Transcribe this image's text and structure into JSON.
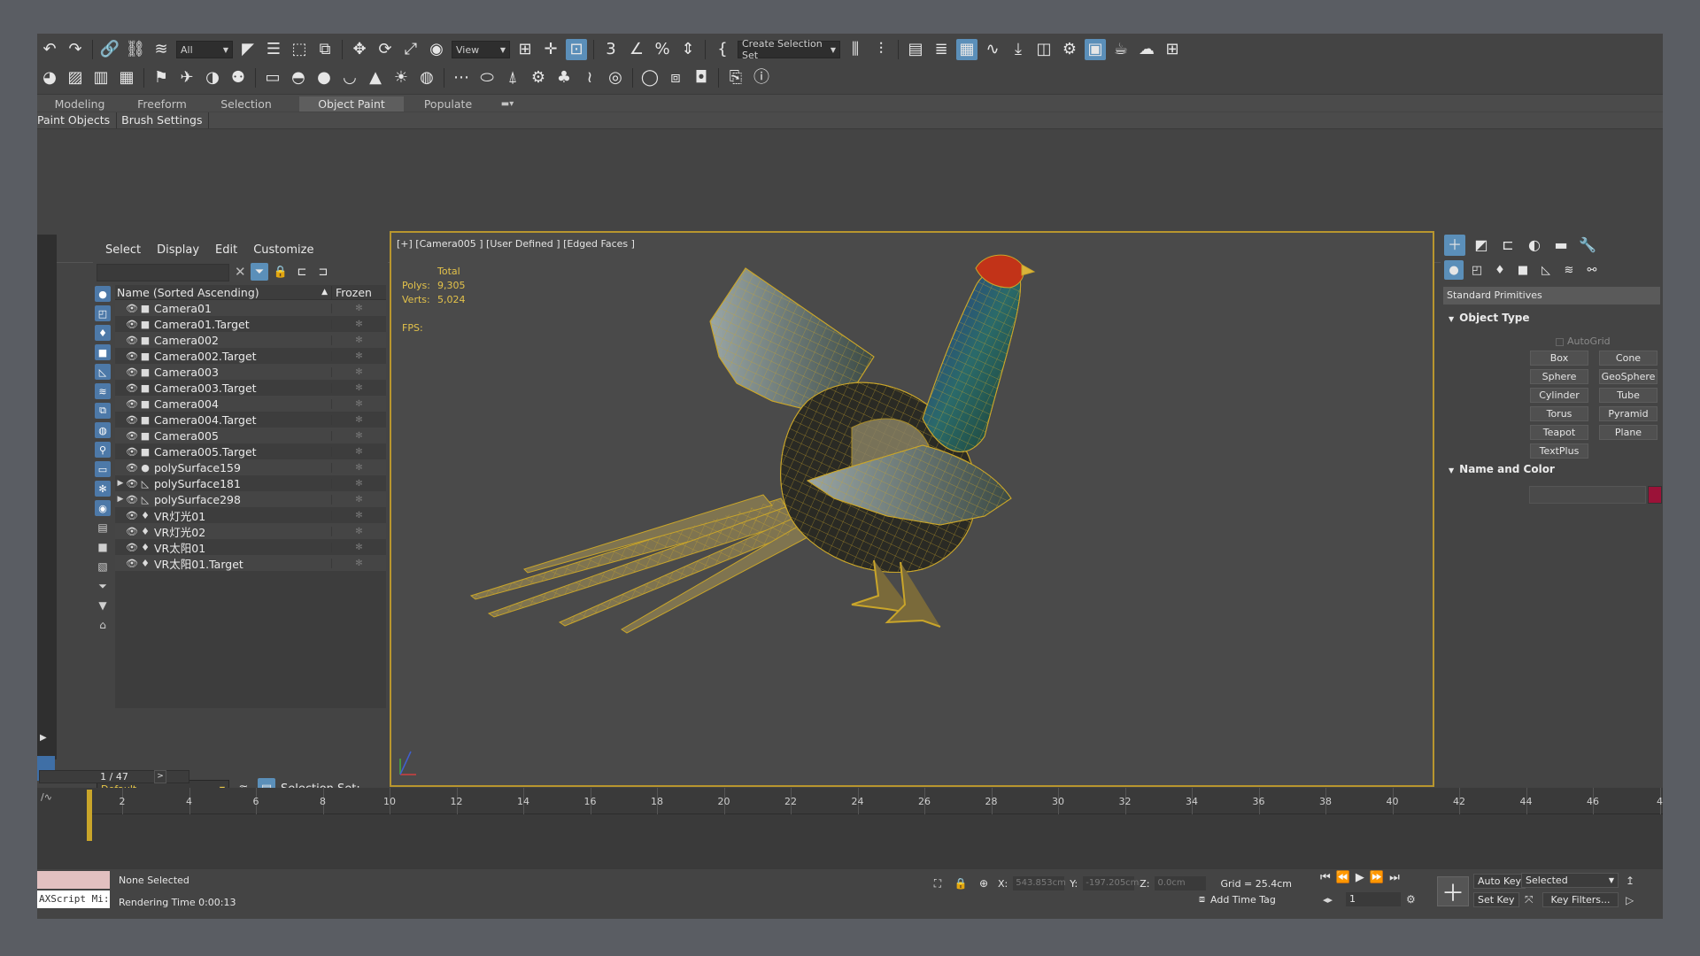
{
  "toolbar": {
    "selection_filter": "All",
    "reference_coord": "View",
    "named_selection": "Create Selection Set"
  },
  "ribbon": {
    "tabs": [
      "Modeling",
      "Freeform",
      "Selection",
      "Object Paint",
      "Populate"
    ],
    "active_tab": "Object Paint",
    "subpanels": [
      "Paint Objects",
      "Brush Settings"
    ]
  },
  "scene_explorer": {
    "menu": [
      "Select",
      "Display",
      "Edit",
      "Customize"
    ],
    "column_name": "Name (Sorted Ascending)",
    "column_frozen": "Frozen",
    "rows": [
      {
        "name": "Camera01",
        "type": "camera-icon",
        "expand": ""
      },
      {
        "name": "Camera01.Target",
        "type": "camera-icon",
        "expand": ""
      },
      {
        "name": "Camera002",
        "type": "camera-icon",
        "expand": ""
      },
      {
        "name": "Camera002.Target",
        "type": "camera-icon",
        "expand": ""
      },
      {
        "name": "Camera003",
        "type": "camera-icon",
        "expand": ""
      },
      {
        "name": "Camera003.Target",
        "type": "camera-icon",
        "expand": ""
      },
      {
        "name": "Camera004",
        "type": "camera-icon",
        "expand": ""
      },
      {
        "name": "Camera004.Target",
        "type": "camera-icon",
        "expand": ""
      },
      {
        "name": "Camera005",
        "type": "camera-icon",
        "expand": ""
      },
      {
        "name": "Camera005.Target",
        "type": "camera-icon",
        "expand": ""
      },
      {
        "name": "polySurface159",
        "type": "geometry-icon",
        "expand": ""
      },
      {
        "name": "polySurface181",
        "type": "bone-icon",
        "expand": "▶"
      },
      {
        "name": "polySurface298",
        "type": "bone-icon",
        "expand": "▶"
      },
      {
        "name": "VR灯光01",
        "type": "light-icon",
        "expand": ""
      },
      {
        "name": "VR灯光02",
        "type": "light-icon",
        "expand": ""
      },
      {
        "name": "VR太阳01",
        "type": "light-icon",
        "expand": ""
      },
      {
        "name": "VR太阳01.Target",
        "type": "light-icon",
        "expand": ""
      }
    ],
    "layer": "Default",
    "selection_set_label": "Selection Set:"
  },
  "viewport": {
    "label": "[+] [Camera005 ] [User Defined ] [Edged Faces ]",
    "stats_header": "Total",
    "polys_label": "Polys:",
    "polys_value": "9,305",
    "verts_label": "Verts:",
    "verts_value": "5,024",
    "fps_label": "FPS:"
  },
  "command_panel": {
    "category": "Standard Primitives",
    "object_type_title": "Object Type",
    "autogrid": "AutoGrid",
    "primitives": [
      "Box",
      "Cone",
      "Sphere",
      "GeoSphere",
      "Cylinder",
      "Tube",
      "Torus",
      "Pyramid",
      "Teapot",
      "Plane",
      "TextPlus"
    ],
    "name_color_title": "Name and Color",
    "swatch_color": "#9b1238"
  },
  "timeline": {
    "frame_display": "1 / 47",
    "ticks": [
      "2",
      "4",
      "6",
      "8",
      "10",
      "12",
      "14",
      "16",
      "18",
      "20",
      "22",
      "24",
      "26",
      "28",
      "30",
      "32",
      "34",
      "36",
      "38",
      "40",
      "42",
      "44",
      "46",
      "4"
    ]
  },
  "status": {
    "maxscript": "AXScript Mi:",
    "selection": "None Selected",
    "render_time": "Rendering Time  0:00:13",
    "x_label": "X:",
    "x_value": "543.853cm",
    "y_label": "Y:",
    "y_value": "-197.205cm",
    "z_label": "Z:",
    "z_value": "0.0cm",
    "grid": "Grid = 25.4cm",
    "add_time_tag": "Add Time Tag",
    "current_frame": "1",
    "auto_key": "Auto Key",
    "set_key": "Set Key",
    "key_mode": "Selected",
    "key_filters": "Key Filters..."
  },
  "colors": {
    "accent": "#5b8fb9",
    "viewport_border": "#b8962e",
    "stats_text": "#e3c24a",
    "wireframe": "#c9a52a"
  }
}
